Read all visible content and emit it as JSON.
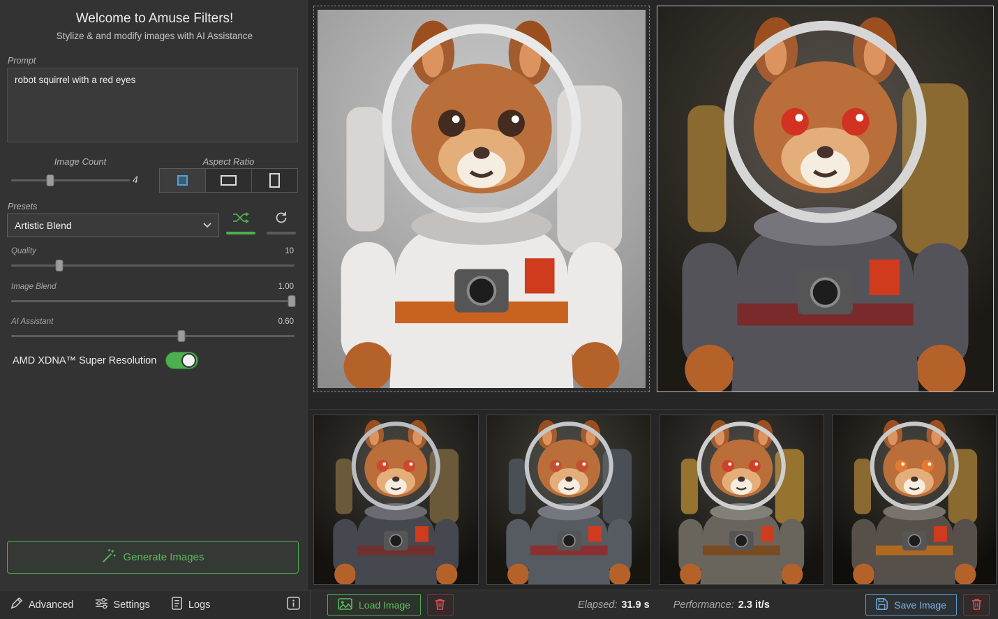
{
  "sidebar": {
    "title": "Welcome to Amuse Filters!",
    "subtitle": "Stylize & and modify images with AI Assistance",
    "prompt": {
      "label": "Prompt",
      "value": "robot squirrel with a red eyes"
    },
    "image_count": {
      "label": "Image Count",
      "value": "4"
    },
    "aspect_ratio": {
      "label": "Aspect Ratio"
    },
    "presets": {
      "label": "Presets",
      "selected": "Artistic Blend"
    },
    "sliders": [
      {
        "label": "Quality",
        "value": "10"
      },
      {
        "label": "Image Blend",
        "value": "1.00"
      },
      {
        "label": "AI Assistant",
        "value": "0.60"
      }
    ],
    "super_resolution_label": "AMD XDNA™ Super Resolution",
    "generate_button": "Generate Images"
  },
  "footer": {
    "advanced": "Advanced",
    "settings": "Settings",
    "logs": "Logs",
    "load_image": "Load Image",
    "elapsed_label": "Elapsed:",
    "elapsed_value": "31.9 s",
    "performance_label": "Performance:",
    "performance_value": "2.3 it/s",
    "save_image": "Save Image"
  },
  "colors": {
    "accent_green": "#4caf50",
    "accent_blue": "#5b9bd5",
    "danger_red": "#e05252",
    "selected_aspect_blue": "#4aa3e0",
    "sidebar_background": "#333333",
    "main_background": "#262626"
  }
}
